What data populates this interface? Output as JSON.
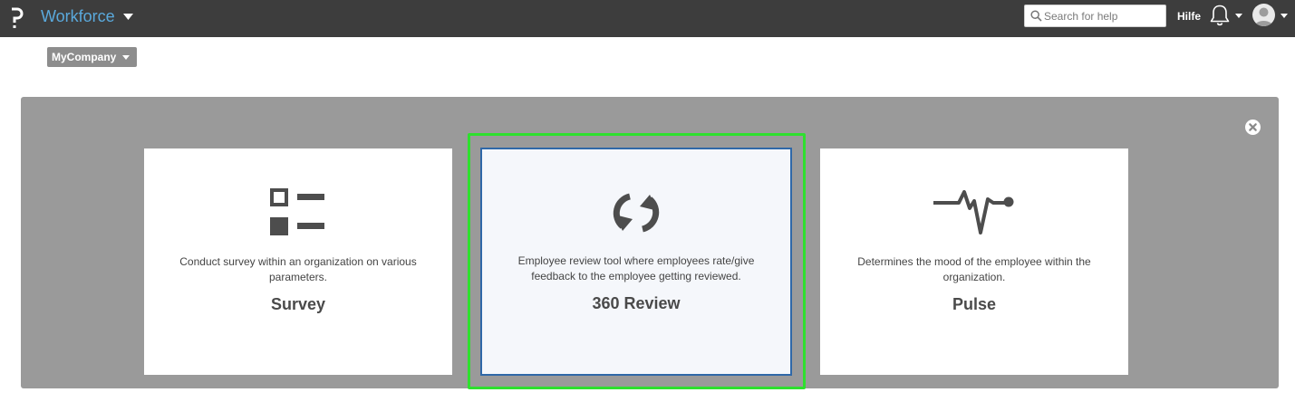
{
  "header": {
    "app_title": "Workforce",
    "search_placeholder": "Search for help",
    "help_label": "Hilfe"
  },
  "company_selector": {
    "value": "MyCompany"
  },
  "cards": [
    {
      "id": "survey",
      "icon": "checklist-icon",
      "description": "Conduct survey within an organization on various parameters.",
      "title": "Survey"
    },
    {
      "id": "360-review",
      "icon": "refresh-icon",
      "description": "Employee review tool where employees rate/give feedback to the employee getting reviewed.",
      "title": "360 Review"
    },
    {
      "id": "pulse",
      "icon": "heartbeat-icon",
      "description": "Determines the mood of the employee within the organization.",
      "title": "Pulse"
    }
  ],
  "colors": {
    "topbar": "#3d3d3d",
    "accent_title": "#5aa9dc",
    "panel": "#9a9a9a",
    "selected_border": "#2f68a8",
    "highlight": "#2ee02e"
  }
}
